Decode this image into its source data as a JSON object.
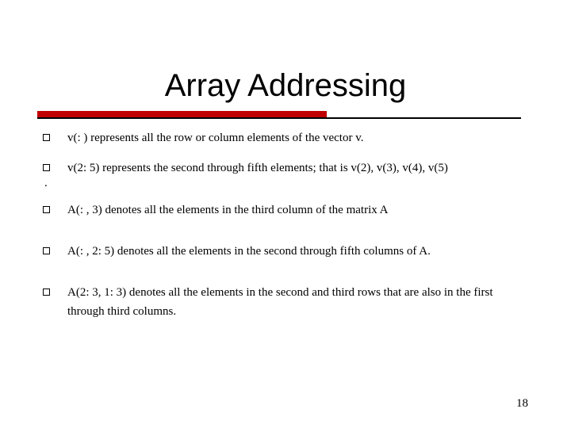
{
  "title": "Array Addressing",
  "bullets": {
    "b1": "v(: ) represents all the row or column elements of the vector v.",
    "b2": "v(2: 5) represents the second through fifth elements; that is v(2), v(3), v(4), v(5)",
    "b3": "A(: , 3) denotes all the elements in the third column of the matrix A",
    "b4": "A(: , 2: 5) denotes all the elements in the second through fifth columns of A.",
    "b5": "A(2: 3, 1: 3) denotes all the elements in the second and third rows that are also in the first through third columns."
  },
  "dot": ".",
  "page_number": "18"
}
